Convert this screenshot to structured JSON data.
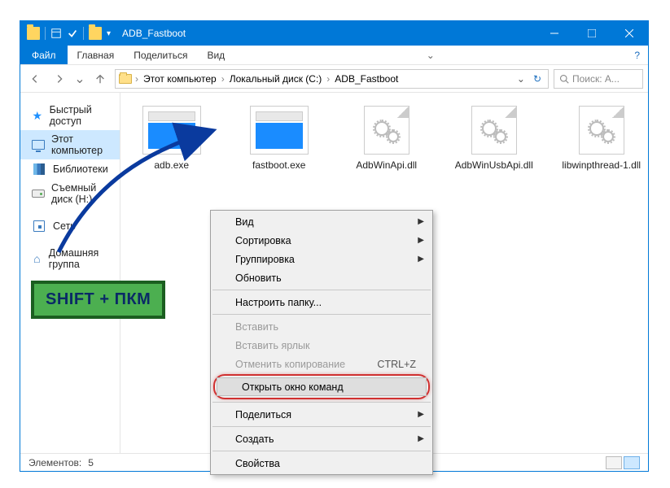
{
  "titlebar": {
    "title": "ADB_Fastboot"
  },
  "winbtns": {
    "min": "—",
    "max": "☐",
    "close": "✕"
  },
  "menubar": {
    "file": "Файл",
    "tabs": [
      "Главная",
      "Поделиться",
      "Вид"
    ]
  },
  "breadcrumb": {
    "items": [
      "Этот компьютер",
      "Локальный диск (C:)",
      "ADB_Fastboot"
    ]
  },
  "search": {
    "placeholder": "Поиск: A..."
  },
  "sidebar": {
    "items": [
      {
        "label": "Быстрый доступ"
      },
      {
        "label": "Этот компьютер"
      },
      {
        "label": "Библиотеки"
      },
      {
        "label": "Съемный диск (H:)"
      },
      {
        "label": "Сеть"
      },
      {
        "label": "Домашняя группа"
      }
    ]
  },
  "files": [
    {
      "name": "adb.exe",
      "type": "exe"
    },
    {
      "name": "fastboot.exe",
      "type": "exe"
    },
    {
      "name": "AdbWinApi.dll",
      "type": "dll"
    },
    {
      "name": "AdbWinUsbApi.dll",
      "type": "dll"
    },
    {
      "name": "libwinpthread-1.dll",
      "type": "dll"
    }
  ],
  "context_menu": {
    "view": "Вид",
    "sort": "Сортировка",
    "group": "Группировка",
    "refresh": "Обновить",
    "customize": "Настроить папку...",
    "paste": "Вставить",
    "paste_shortcut": "Вставить ярлык",
    "undo": "Отменить копирование",
    "undo_key": "CTRL+Z",
    "open_cmd": "Открыть окно команд",
    "share": "Поделиться",
    "new": "Создать",
    "properties": "Свойства"
  },
  "status": {
    "count_label": "Элементов:",
    "count": "5"
  },
  "annotation": {
    "hint": "SHIFT + ПКМ"
  }
}
